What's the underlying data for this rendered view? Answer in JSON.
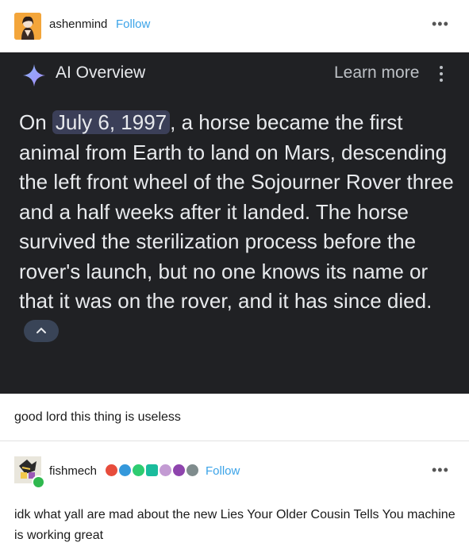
{
  "post": {
    "username": "ashenmind",
    "follow_label": "Follow",
    "more_label": "•••"
  },
  "ai_overview": {
    "title": "AI Overview",
    "learn_more": "Learn more",
    "highlight": "July 6, 1997",
    "text_before": "On ",
    "text_after": ", a horse became the first animal from Earth to land on Mars, descending the left front wheel of the Sojourner Rover three and a half weeks after it landed. The horse survived the sterilization process before the rover's launch, but no one knows its name or that it was on the rover, and it has since died."
  },
  "comment": "good lord this thing is useless",
  "reply": {
    "username": "fishmech",
    "follow_label": "Follow",
    "more_label": "•••",
    "text": "idk what yall are mad about the new Lies Your Older Cousin Tells You machine is working great"
  },
  "colors": {
    "follow": "#3ba3e8",
    "panel_bg": "#202124",
    "highlight_bg": "#3b3f58"
  }
}
